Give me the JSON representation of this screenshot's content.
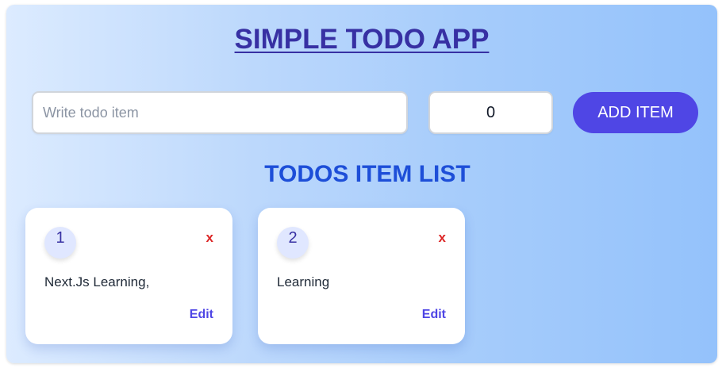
{
  "header": {
    "title": "SIMPLE TODO APP"
  },
  "form": {
    "todo_placeholder": "Write todo item",
    "todo_value": "",
    "number_value": "0",
    "add_label": "ADD ITEM"
  },
  "list": {
    "title": "TODOS ITEM LIST",
    "items": [
      {
        "number": "1",
        "text": "Next.Js Learning,",
        "delete_label": "x",
        "edit_label": "Edit"
      },
      {
        "number": "2",
        "text": "Learning",
        "delete_label": "x",
        "edit_label": "Edit"
      }
    ]
  },
  "colors": {
    "accent": "#4f46e5",
    "title": "#3730a3",
    "list_title": "#1d4ed8",
    "delete": "#dc2626"
  }
}
